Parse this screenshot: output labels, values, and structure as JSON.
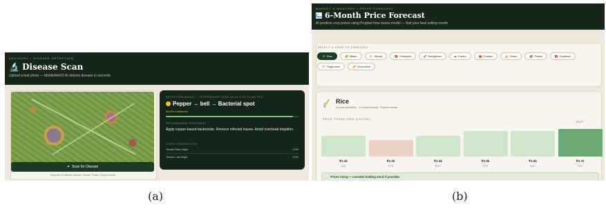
{
  "panel_a": {
    "breadcrumb": "ADVISORY • DISEASE DETECTION",
    "title_icon": "microscope-icon",
    "title": "Disease Scan",
    "subtitle": "Upload a leaf photo — MobileNetV2 AI detects disease in seconds",
    "scan_button": "Scan for Disease",
    "scan_icon": "sparkle-icon",
    "support_text": "Supports 15 disease classes: Tomato, Potato, Pepper leaves",
    "result": {
      "meta": "DETECTION RESULT · SCREENSHOT 2026-05-01 6:35:21 AM PKO",
      "diagnosis": "Pepper → bell → Bacterial spot",
      "confidence_text": "95.8% confidence",
      "confidence_value": 0.958,
      "treatment_label": "RECOMMENDED TREATMENT",
      "treatment": "Apply copper-based bactericide. Remove infected leaves. Avoid overhead irrigation.",
      "others_label": "OTHER POSSIBILITIES",
      "others": [
        {
          "name": "Tomato Early blight",
          "pct": "3.0%"
        },
        {
          "name": "Tomato Late blight",
          "pct": "0.0%"
        }
      ]
    },
    "caption": "(a)"
  },
  "panel_b": {
    "breadcrumb": "MARKET & WEATHER • PRICE FORECAST",
    "title_icon": "chart-icon",
    "title": "6-Month Price Forecast",
    "subtitle": "AI predicts crop prices using Prophet time-series model — find your best selling month",
    "select_label": "SELECT A CROP TO FORECAST",
    "crops": [
      {
        "label": "Rice",
        "icon": "🌾",
        "selected": true
      },
      {
        "label": "Maize",
        "icon": "🌽",
        "selected": false
      },
      {
        "label": "Wheat",
        "icon": "🌾",
        "selected": false
      },
      {
        "label": "Chickpea",
        "icon": "🫘",
        "selected": false
      },
      {
        "label": "Mungbean",
        "icon": "🫛",
        "selected": false
      },
      {
        "label": "Cotton",
        "icon": "☁",
        "selected": false
      },
      {
        "label": "Tomato",
        "icon": "🍅",
        "selected": false
      },
      {
        "label": "Onion",
        "icon": "🧅",
        "selected": false
      },
      {
        "label": "Potato",
        "icon": "🥔",
        "selected": false
      },
      {
        "label": "Soybean",
        "icon": "🫘",
        "selected": false
      },
      {
        "label": "Sugarcane",
        "icon": "🎋",
        "selected": false
      },
      {
        "label": "Groundnut",
        "icon": "🥜",
        "selected": false
      }
    ],
    "crop_name": "Rice",
    "crop_sub": "AI price prediction · 6 months ahead · Prophet model",
    "trend_label": "PRICE TREND (PER QUINTAL)",
    "best_label": "BEST",
    "advice": "📈 Prices rising — consider holding stock if possible.",
    "caption": "(b)"
  },
  "chart_data": {
    "type": "bar",
    "categories": [
      "JAN",
      "FEB",
      "MAR",
      "APR",
      "MAY",
      "JUN"
    ],
    "value_labels": [
      "₹2.4k",
      "₹2.2k",
      "₹2.4k",
      "₹2.6k",
      "₹2.6k",
      "₹2.7k"
    ],
    "values": [
      2400,
      2200,
      2400,
      2600,
      2600,
      2700
    ],
    "ylabel": "PRICE TREND (PER QUINTAL)",
    "best_index": 5,
    "colors": {
      "rising": "#cfe6cd",
      "falling": "#ecd2c6",
      "best": "#6aa874"
    }
  }
}
